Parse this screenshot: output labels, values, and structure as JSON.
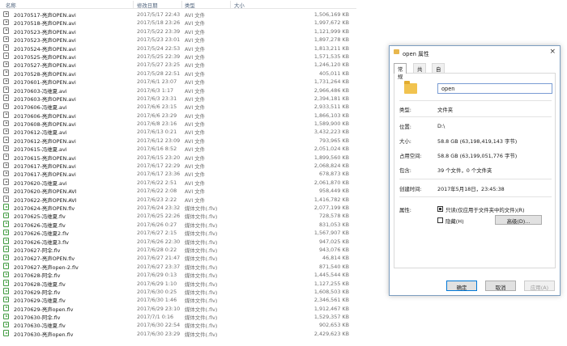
{
  "columns": {
    "name": "名称",
    "date": "修改日期",
    "type": "类型",
    "size": "大小"
  },
  "files": [
    {
      "name": "20170517-亮声OPEN.avi",
      "date": "2017/5/17 22:43",
      "type": "AVI 文件",
      "size": "1,506,169 KB",
      "icon": "avi-file-icon"
    },
    {
      "name": "20170518-亮声OPEN.avi",
      "date": "2017/5/18 23:26",
      "type": "AVI 文件",
      "size": "1,997,672 KB",
      "icon": "avi-file-icon"
    },
    {
      "name": "20170523-亮声OPEN.avi",
      "date": "2017/5/22 23:39",
      "type": "AVI 文件",
      "size": "1,121,999 KB",
      "icon": "avi-file-icon"
    },
    {
      "name": "20170523-亮声OPEN.avi",
      "date": "2017/5/23 23:01",
      "type": "AVI 文件",
      "size": "1,897,278 KB",
      "icon": "avi-file-icon"
    },
    {
      "name": "20170524-亮声OPEN.avi",
      "date": "2017/5/24 22:53",
      "type": "AVI 文件",
      "size": "1,813,211 KB",
      "icon": "avi-file-icon"
    },
    {
      "name": "20170525-亮声OPEN.avi",
      "date": "2017/5/25 22:39",
      "type": "AVI 文件",
      "size": "1,571,535 KB",
      "icon": "avi-file-icon"
    },
    {
      "name": "20170527-亮声OPEN.avi",
      "date": "2017/5/27 23:25",
      "type": "AVI 文件",
      "size": "1,246,120 KB",
      "icon": "avi-file-icon"
    },
    {
      "name": "20170528-亮声OPEN.avi",
      "date": "2017/5/28 22:51",
      "type": "AVI 文件",
      "size": "405,011 KB",
      "icon": "avi-file-icon"
    },
    {
      "name": "20170601-亮声OPEN.avi",
      "date": "2017/6/1 23:07",
      "type": "AVI 文件",
      "size": "1,731,264 KB",
      "icon": "avi-file-icon"
    },
    {
      "name": "20170603-冯维夏.avi",
      "date": "2017/6/3 1:17",
      "type": "AVI 文件",
      "size": "2,966,486 KB",
      "icon": "avi-file-icon"
    },
    {
      "name": "20170603-亮声OPEN.avi",
      "date": "2017/6/3 23:31",
      "type": "AVI 文件",
      "size": "2,394,181 KB",
      "icon": "avi-file-icon"
    },
    {
      "name": "20170606-冯维夏.avi",
      "date": "2017/6/6 23:15",
      "type": "AVI 文件",
      "size": "2,933,511 KB",
      "icon": "avi-file-icon"
    },
    {
      "name": "20170606-亮声OPEN.avi",
      "date": "2017/6/6 23:29",
      "type": "AVI 文件",
      "size": "1,866,103 KB",
      "icon": "avi-file-icon"
    },
    {
      "name": "20170608-亮声OPEN.avi",
      "date": "2017/6/8 23:16",
      "type": "AVI 文件",
      "size": "1,589,900 KB",
      "icon": "avi-file-icon"
    },
    {
      "name": "20170612-冯维夏.avi",
      "date": "2017/6/13 0:21",
      "type": "AVI 文件",
      "size": "3,432,223 KB",
      "icon": "avi-file-icon"
    },
    {
      "name": "20170612-亮声OPEN.avi",
      "date": "2017/6/12 23:09",
      "type": "AVI 文件",
      "size": "793,965 KB",
      "icon": "avi-file-icon"
    },
    {
      "name": "20170615-冯维夏.avi",
      "date": "2017/6/16 8:52",
      "type": "AVI 文件",
      "size": "2,051,024 KB",
      "icon": "avi-file-icon"
    },
    {
      "name": "20170615-亮声OPEN.avi",
      "date": "2017/6/15 23:20",
      "type": "AVI 文件",
      "size": "1,899,560 KB",
      "icon": "avi-file-icon"
    },
    {
      "name": "20170617-亮声OPEN.avi",
      "date": "2017/6/17 22:29",
      "type": "AVI 文件",
      "size": "2,068,824 KB",
      "icon": "avi-file-icon"
    },
    {
      "name": "20170617-亮声OPEN.avi",
      "date": "2017/6/17 23:36",
      "type": "AVI 文件",
      "size": "678,873 KB",
      "icon": "avi-file-icon"
    },
    {
      "name": "20170620-冯维夏.avi",
      "date": "2017/6/22 2:51",
      "type": "AVI 文件",
      "size": "2,061,870 KB",
      "icon": "avi-file-icon"
    },
    {
      "name": "20170620-亮声OPEN.AVI",
      "date": "2017/6/22 2:08",
      "type": "AVI 文件",
      "size": "958,449 KB",
      "icon": "avi-file-icon"
    },
    {
      "name": "20170622-亮声OPEN.AVI",
      "date": "2017/6/23 2:22",
      "type": "AVI 文件",
      "size": "1,416,782 KB",
      "icon": "avi-file-icon"
    },
    {
      "name": "20170624-亮声OPEN.flv",
      "date": "2017/6/24 23:32",
      "type": "媒体文件(.flv)",
      "size": "2,077,199 KB",
      "icon": "flv-file-icon"
    },
    {
      "name": "20170625-冯维夏.flv",
      "date": "2017/6/25 22:26",
      "type": "媒体文件(.flv)",
      "size": "728,578 KB",
      "icon": "flv-file-icon"
    },
    {
      "name": "20170626-冯维夏.flv",
      "date": "2017/6/26 0:27",
      "type": "媒体文件(.flv)",
      "size": "831,053 KB",
      "icon": "flv-file-icon"
    },
    {
      "name": "20170626-冯维夏2.flv",
      "date": "2017/6/27 2:15",
      "type": "媒体文件(.flv)",
      "size": "1,567,907 KB",
      "icon": "flv-file-icon"
    },
    {
      "name": "20170626-冯维夏3.flv",
      "date": "2017/6/26 22:30",
      "type": "媒体文件(.flv)",
      "size": "947,025 KB",
      "icon": "flv-file-icon"
    },
    {
      "name": "20170627-阿伞.flv",
      "date": "2017/6/28 0:22",
      "type": "媒体文件(.flv)",
      "size": "943,076 KB",
      "icon": "flv-file-icon"
    },
    {
      "name": "20170627-亮声OPEN.flv",
      "date": "2017/6/27 21:47",
      "type": "媒体文件(.flv)",
      "size": "46,814 KB",
      "icon": "flv-file-icon"
    },
    {
      "name": "20170627-亮声open-2.flv",
      "date": "2017/6/27 23:37",
      "type": "媒体文件(.flv)",
      "size": "871,540 KB",
      "icon": "flv-file-icon"
    },
    {
      "name": "20170628-阿伞.flv",
      "date": "2017/6/29 0:13",
      "type": "媒体文件(.flv)",
      "size": "1,445,544 KB",
      "icon": "flv-file-icon"
    },
    {
      "name": "20170628-冯维夏.flv",
      "date": "2017/6/29 1:10",
      "type": "媒体文件(.flv)",
      "size": "1,127,255 KB",
      "icon": "flv-file-icon"
    },
    {
      "name": "20170629-阿伞.flv",
      "date": "2017/6/30 0:25",
      "type": "媒体文件(.flv)",
      "size": "1,608,503 KB",
      "icon": "flv-file-icon"
    },
    {
      "name": "20170629-冯维夏.flv",
      "date": "2017/6/30 1:46",
      "type": "媒体文件(.flv)",
      "size": "2,346,561 KB",
      "icon": "flv-file-icon"
    },
    {
      "name": "20170629-亮声open.flv",
      "date": "2017/6/29 23:10",
      "type": "媒体文件(.flv)",
      "size": "1,912,467 KB",
      "icon": "flv-file-icon"
    },
    {
      "name": "20170630-阿伞.flv",
      "date": "2017/7/1 0:16",
      "type": "媒体文件(.flv)",
      "size": "1,529,357 KB",
      "icon": "flv-file-icon"
    },
    {
      "name": "20170630-冯维夏.flv",
      "date": "2017/6/30 22:54",
      "type": "媒体文件(.flv)",
      "size": "902,653 KB",
      "icon": "flv-file-icon"
    },
    {
      "name": "20170630-亮声open.flv",
      "date": "2017/6/30 23:29",
      "type": "媒体文件(.flv)",
      "size": "2,429,623 KB",
      "icon": "flv-file-icon"
    }
  ],
  "dialog": {
    "title": "open 属性",
    "close_glyph": "×",
    "tabs": [
      "常规",
      "共享",
      "自定义"
    ],
    "folder_name": "open",
    "fields": {
      "type_label": "类型:",
      "type_value": "文件夹",
      "location_label": "位置:",
      "location_value": "D:\\",
      "size_label": "大小:",
      "size_value": "58.8 GB (63,198,419,143 字节)",
      "disk_label": "占用空间:",
      "disk_value": "58.8 GB (63,199,051,776 字节)",
      "contains_label": "包含:",
      "contains_value": "39 个文件，0 个文件夹",
      "created_label": "创建时间:",
      "created_value": "2017年5月18日，23:45:38",
      "attr_label": "属性:",
      "readonly_label": "只读(仅应用于文件夹中的文件)(R)",
      "hidden_label": "隐藏(H)",
      "advanced_label": "高级(D)..."
    },
    "attributes": {
      "readonly": "indeterminate",
      "hidden": false
    },
    "buttons": {
      "ok": "确定",
      "cancel": "取消",
      "apply": "应用(A)"
    }
  }
}
